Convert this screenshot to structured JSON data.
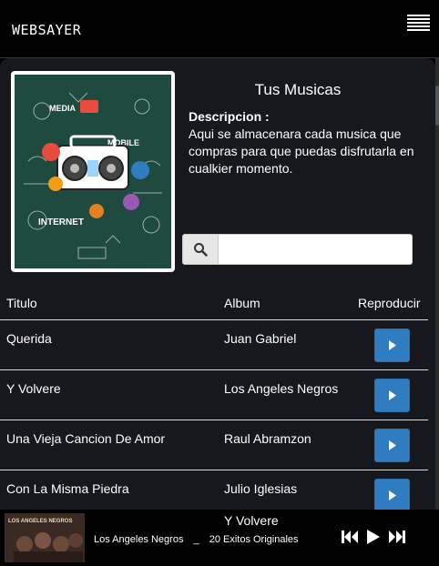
{
  "app": {
    "brand": "WEBSAYER",
    "menu_icon": "hamburger-icon"
  },
  "library": {
    "title": "Tus Musicas",
    "description_label": "Descripcion :",
    "description_text": "Aqui se almacenara cada musica que compras para que puedas disfrutarla en cualkier momento.",
    "cover_words": {
      "media": "MEDIA",
      "mobile": "MOBILE",
      "internet": "INTERNET"
    }
  },
  "search": {
    "value": "",
    "placeholder": "",
    "icon": "search-icon"
  },
  "table": {
    "headers": {
      "title": "Titulo",
      "album": "Album",
      "play": "Reproducir"
    },
    "rows": [
      {
        "title": "Querida",
        "album": "Juan Gabriel"
      },
      {
        "title": "Y Volvere",
        "album": "Los Angeles Negros"
      },
      {
        "title": "Una Vieja Cancion De Amor",
        "album": "Raul Abramzon"
      },
      {
        "title": "Con La Misma Piedra",
        "album": "Julio Iglesias"
      }
    ]
  },
  "player": {
    "track": "Y Volvere",
    "artist": "Los Angeles Negros",
    "separator": "_",
    "album": "20 Exitos Originales",
    "art_caption": "LOS ANGELES NEGROS",
    "controls": [
      "previous-icon",
      "play-icon",
      "next-icon"
    ]
  },
  "colors": {
    "play_button": "#2f7cc1",
    "panel": "#16181d",
    "cover_bg": "#1f4a3f"
  }
}
